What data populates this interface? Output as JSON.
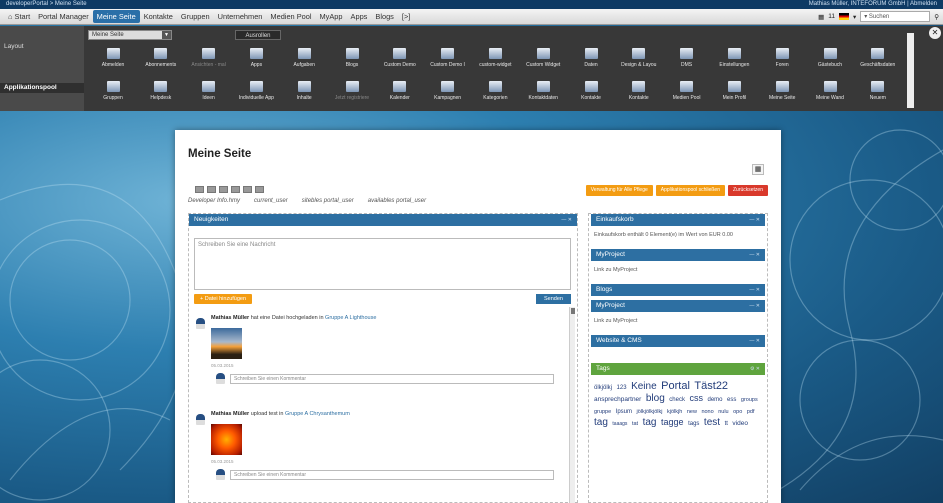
{
  "topbar": {
    "left": "developerPortal > Meine Seite",
    "right": "Mathias Müller, INTEFORUM GmbH | Abmelden"
  },
  "nav": {
    "items": [
      "⌂ Start",
      "Portal Manager",
      "Meine Seite",
      "Kontakte",
      "Gruppen",
      "Unternehmen",
      "Medien Pool",
      "MyApp",
      "Apps",
      "Blogs",
      "[>]"
    ],
    "active_index": 2,
    "right": {
      "count": "11",
      "search_label": "▾ Suchen"
    }
  },
  "panel": {
    "left_labels": [
      "Layout",
      "Applikationspool"
    ],
    "select_value": "Meine Seite",
    "apply_label": "Ausrollen",
    "row1": [
      "Abmelden",
      "Abonnements",
      "Ansichten - mal",
      "Apps",
      "Aufgaben",
      "Blogs",
      "Custom Demo",
      "Custom Demo I",
      "custom-widget",
      "Custom Widget",
      "Daten",
      "Design & Layou",
      "DMS",
      "Einstellungen",
      "Foren",
      "Gästebuch",
      "Geschäftsdaten"
    ],
    "row2": [
      "Gruppen",
      "Helpdesk",
      "Ideen",
      "Individuelle App",
      "Inhalte",
      "Jetzt registriere",
      "Kalender",
      "Kampagnen",
      "Kategorien",
      "Kontaktdaten",
      "Kontakte",
      "Kontakte",
      "Medien Pool",
      "Mein Profil",
      "Meine Seite",
      "Meine Wand",
      "Neuem"
    ],
    "row1_dim": [
      2
    ],
    "row2_dim": [
      5
    ]
  },
  "page": {
    "title": "Meine Seite",
    "dev_links": [
      "Developer Info.hmy",
      "current_user",
      "sitebles portal_user",
      "availables portal_user"
    ],
    "action_buttons": [
      "Verwaltung für Alle Pflege",
      "Applikationspool schließen",
      "Zurücksetzen"
    ]
  },
  "feed": {
    "header": "Neuigkeiten",
    "compose_placeholder": "Schreiben Sie eine Nachricht",
    "add_label": "+ Datei hinzufügen",
    "send_label": "Senden",
    "posts": [
      {
        "author": "Mathias Müller",
        "text": " hat eine Datei hochgeladen in ",
        "target": "Gruppe A Lighthouse",
        "date": "05.03.2015",
        "comment_placeholder": "Schreiben Sie einen Kommentar"
      },
      {
        "author": "Mathias Müller",
        "text": " upload test in ",
        "target": "Gruppe A Chrysanthemum",
        "date": "05.03.2015",
        "comment_placeholder": "Schreiben Sie einen Kommentar"
      }
    ]
  },
  "sidebar": [
    {
      "title": "Einkaufskorb",
      "body": "Einkaufskorb enthält 0 Element(e) im Wert von EUR 0.00"
    },
    {
      "title": "MyProject",
      "body": "Link zu MyProject"
    },
    {
      "title": "Blogs",
      "body": ""
    },
    {
      "title": "MyProject",
      "body": "Link zu MyProject"
    },
    {
      "title": "Website & CMS",
      "body": ""
    },
    {
      "title": "Tags",
      "body": ""
    }
  ],
  "tags": [
    "ölkjölkj",
    "123",
    "Keine",
    "Portal",
    "Täst22",
    "ansprechpartner",
    "blog",
    "check",
    "css",
    "demo",
    "ess",
    "groups",
    "gruppe",
    "Ipsum",
    "jölkjölkjölkj",
    "kjölkjh",
    "new",
    "nono",
    "nulu",
    "opo",
    "pdf",
    "tag",
    "taaags",
    "tat",
    "tag",
    "tagge",
    "tags",
    "test",
    "tt",
    "video"
  ]
}
